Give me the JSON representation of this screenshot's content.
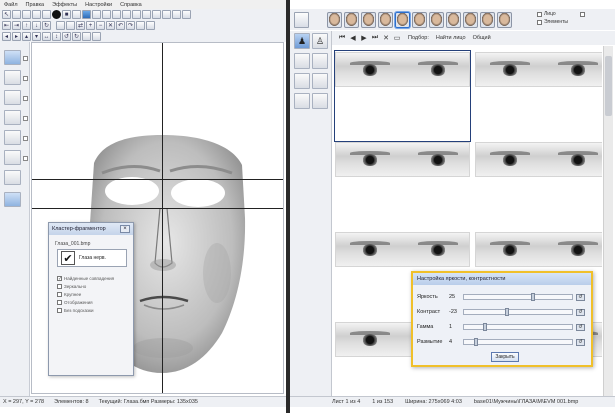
{
  "menu": {
    "items": [
      "Файл",
      "Правка",
      "Эффекты",
      "Настройки",
      "Справка"
    ]
  },
  "left_status": {
    "coords": "X = 297, Y = 278",
    "elements": "Элементов: 8",
    "current": "Текущий: Глаза.бмп  Размеры: 135x035"
  },
  "small_dialog": {
    "title": "Кластер-фрагментор",
    "filename": "Глаза_001.bmp",
    "check_label": "Глаза нерв.",
    "options": [
      "Найденные совпадения",
      "Зеркально",
      "Крупнее",
      "Отображения",
      "Без подсказки"
    ]
  },
  "right_toolbar": {
    "nav_prev": "◀",
    "nav_next": "▶",
    "nav_first": "⏮",
    "nav_last": "⏭",
    "close": "✕",
    "filter_label": "Подбор:",
    "label2": "Найти лицо",
    "label3": "Общий"
  },
  "right_top": {
    "check1_label": "Лицо",
    "check2_label": "Элементы"
  },
  "right_status": {
    "page": "Лист 1 из 4",
    "count": "1 из 153",
    "size": "Ширина: 275x069  4:03",
    "path": "base01\\Мужчины\\ГЛАЗА\\М\\EVM 001.bmp"
  },
  "brightness_dialog": {
    "title": "Настройка яркости, контрастности",
    "rows": [
      {
        "label": "Яркость",
        "value": "25",
        "level": 0.62
      },
      {
        "label": "Контраст",
        "value": "-23",
        "level": 0.38
      },
      {
        "label": "Гамма",
        "value": "1",
        "level": 0.18
      },
      {
        "label": "Размытие",
        "value": "4",
        "level": 0.09
      }
    ],
    "close_label": "Закрыть",
    "reset_glyph": "↺"
  },
  "gallery": {
    "rows": 4,
    "cols": 2
  }
}
